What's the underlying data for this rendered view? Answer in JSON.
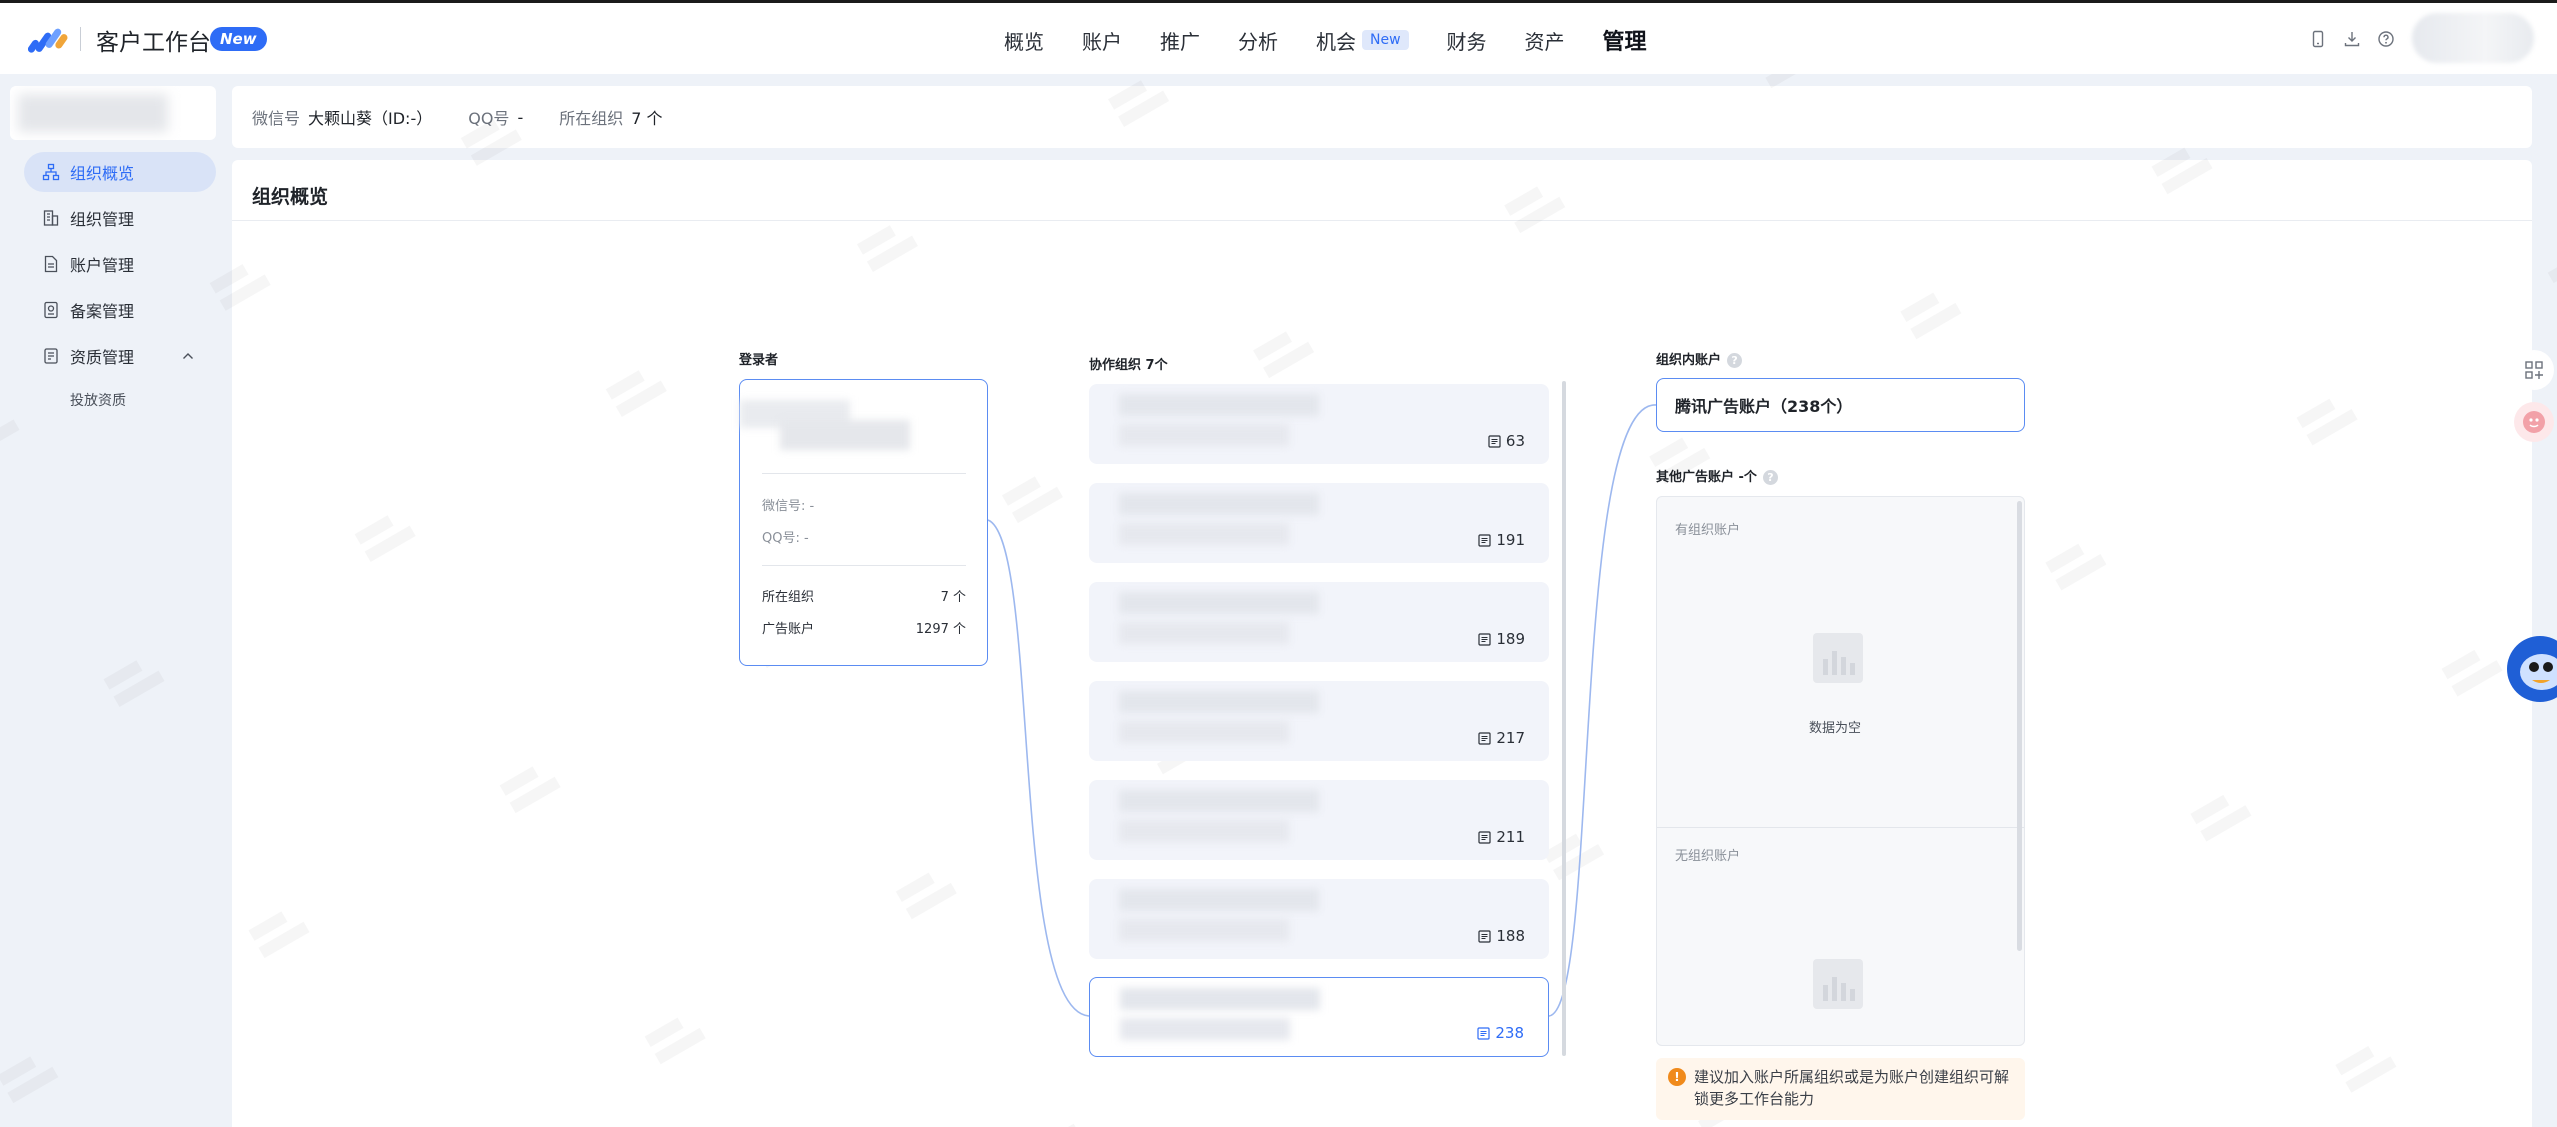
{
  "brand": {
    "title": "客户工作台",
    "badge": "New"
  },
  "nav": {
    "items": [
      {
        "label": "概览"
      },
      {
        "label": "账户"
      },
      {
        "label": "推广"
      },
      {
        "label": "分析"
      },
      {
        "label": "机会",
        "badge": "New"
      },
      {
        "label": "财务"
      },
      {
        "label": "资产"
      },
      {
        "label": "管理",
        "active": true
      }
    ]
  },
  "sidebar": {
    "items": [
      {
        "label": "组织概览"
      },
      {
        "label": "组织管理"
      },
      {
        "label": "账户管理"
      },
      {
        "label": "备案管理"
      },
      {
        "label": "资质管理"
      }
    ],
    "sub_items": [
      {
        "label": "投放资质"
      }
    ]
  },
  "infobar": {
    "wechat_label": "微信号",
    "wechat_value": "大颗山葵（ID:-）",
    "qq_label": "QQ号",
    "qq_value": "-",
    "org_label": "所在组织",
    "org_value": "7 个"
  },
  "panel": {
    "title": "组织概览"
  },
  "login": {
    "label": "登录者",
    "wechat": "微信号: -",
    "qq": "QQ号: -",
    "org_label": "所在组织",
    "org_value": "7 个",
    "ad_label": "广告账户",
    "ad_value": "1297 个"
  },
  "collab": {
    "label": "协作组织 7个",
    "orgs": [
      {
        "count": "63"
      },
      {
        "count": "191"
      },
      {
        "count": "189"
      },
      {
        "count": "217"
      },
      {
        "count": "211"
      },
      {
        "count": "188"
      },
      {
        "count": "238",
        "selected": true
      }
    ]
  },
  "accounts": {
    "label": "组织内账户",
    "tencent": "腾讯广告账户（238个）",
    "other_label": "其他广告账户 -个",
    "with_org": "有组织账户",
    "without_org": "无组织账户",
    "empty": "数据为空"
  },
  "tip": {
    "text": "建议加入账户所属组织或是为账户创建组织可解锁更多工作台能力"
  },
  "colors": {
    "accent": "#2e6cf6",
    "border_active": "#5b8cf2",
    "warning": "#f08a1b"
  }
}
